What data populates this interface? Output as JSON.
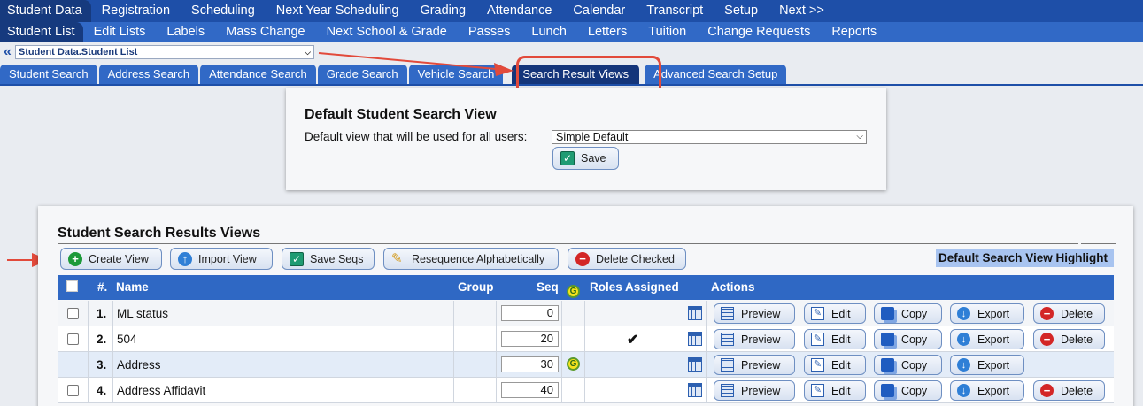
{
  "top_nav": [
    "Student Data",
    "Registration",
    "Scheduling",
    "Next Year Scheduling",
    "Grading",
    "Attendance",
    "Calendar",
    "Transcript",
    "Setup",
    "Next >>"
  ],
  "sub_nav": [
    "Student List",
    "Edit Lists",
    "Labels",
    "Mass Change",
    "Next School & Grade",
    "Passes",
    "Lunch",
    "Letters",
    "Tuition",
    "Change Requests",
    "Reports"
  ],
  "breadcrumb": {
    "chevron": "«",
    "select_value": "Student Data.Student List"
  },
  "tabs": [
    "Student Search",
    "Address Search",
    "Attendance Search",
    "Grade Search",
    "Vehicle Search",
    "Search Result Views",
    "Advanced Search Setup"
  ],
  "default_panel": {
    "title": "Default Student Search View",
    "label": "Default view that will be used for all users:",
    "select_value": "Simple Default",
    "save_label": "Save"
  },
  "results_panel": {
    "title": "Student Search Results Views",
    "toolbar": {
      "create": "Create View",
      "import": "Import View",
      "save_seqs": "Save Seqs",
      "resequence": "Resequence Alphabetically",
      "delete_checked": "Delete Checked"
    },
    "highlight_label": "Default Search View Highlight",
    "columns": {
      "num": "#.",
      "name": "Name",
      "group": "Group",
      "seq": "Seq",
      "g": "G",
      "roles": "Roles Assigned",
      "actions": "Actions"
    },
    "row_actions": {
      "preview": "Preview",
      "edit": "Edit",
      "copy": "Copy",
      "export": "Export",
      "delete": "Delete"
    },
    "rows": [
      {
        "num": "1.",
        "name": "ML status",
        "seq": "0",
        "roles": "",
        "global": false,
        "checkbox": true,
        "delete": true
      },
      {
        "num": "2.",
        "name": "504",
        "seq": "20",
        "roles": "✔",
        "global": false,
        "checkbox": true,
        "delete": true
      },
      {
        "num": "3.",
        "name": "Address",
        "seq": "30",
        "roles": "",
        "global": true,
        "checkbox": false,
        "delete": false
      },
      {
        "num": "4.",
        "name": "Address Affidavit",
        "seq": "40",
        "roles": "",
        "global": false,
        "checkbox": true,
        "delete": true
      }
    ]
  },
  "colors": {
    "nav": "#1e4fa8",
    "subnav": "#3169c6",
    "header": "#2f68c4",
    "annotation": "#e24a3b",
    "highlight": "#a8c4f0"
  }
}
